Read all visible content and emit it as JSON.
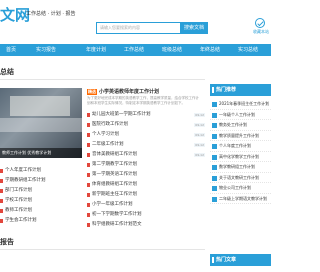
{
  "header": {
    "logo_char": "文",
    "logo_text": "文网",
    "slogan": "工作总结 · 计划 · 报告",
    "search_placeholder": "请输入您要搜索的内容",
    "search_button": "搜索文档",
    "favorite_label": "收藏本站"
  },
  "nav": {
    "items": [
      "首页",
      "实习报告",
      "年度计划",
      "工作总结",
      "班级总结",
      "年终总结",
      "实习总结"
    ]
  },
  "main": {
    "section_title": "总结",
    "feature_caption": "教师工作计划 优秀教学计划",
    "featured": {
      "badge": "精选",
      "title": "小学英语教师年度工作计划",
      "description": "为了更好地完成本学期的英语教学工作，提高教学质量，结合学校工作计划和本班学生实际情况，特制定本学期英语教学工作计划如下。"
    },
    "list_a": [
      {
        "text": "幼儿园大班第一学期工作计划",
        "date": "09-12"
      },
      {
        "text": "医院行政工作计划",
        "date": "09-12"
      },
      {
        "text": "个人学习计划",
        "date": "09-12"
      },
      {
        "text": "二年级工作计划",
        "date": "09-12"
      },
      {
        "text": "音体美教研组工作计划",
        "date": "09-12"
      }
    ],
    "list_left": [
      "个人年度工作计划",
      "学期教研组工作计划",
      "部门工作计划",
      "学校工作计划",
      "教师工作计划",
      "学生会工作计划"
    ],
    "list_right": [
      "第二学期教学工作计划",
      "第一学期英语工作计划",
      "体育组教研组工作计划",
      "新学期班主任工作计划",
      "小学一年级工作计划",
      "初一下学期数学工作计划",
      "科学组教研工作计划范文"
    ],
    "section_title2": "报告"
  },
  "sidebar": {
    "title": "热门推荐",
    "items": [
      "2021年春季班主任工作计划",
      "一年级个人工作计划",
      "教务处工作计划",
      "教学质量提升工作计划",
      "个人年度工作计划",
      "高中化学教学工作计划",
      "数学教研组工作计划",
      "关于语文教研工作计划",
      "物业公司工作计划",
      "二年级上学期语文教学计划"
    ],
    "title2": "热门文章"
  },
  "colors": {
    "primary": "#2a9fd8",
    "badge": "#ff6a00",
    "doc_icon": "#e2473d"
  }
}
